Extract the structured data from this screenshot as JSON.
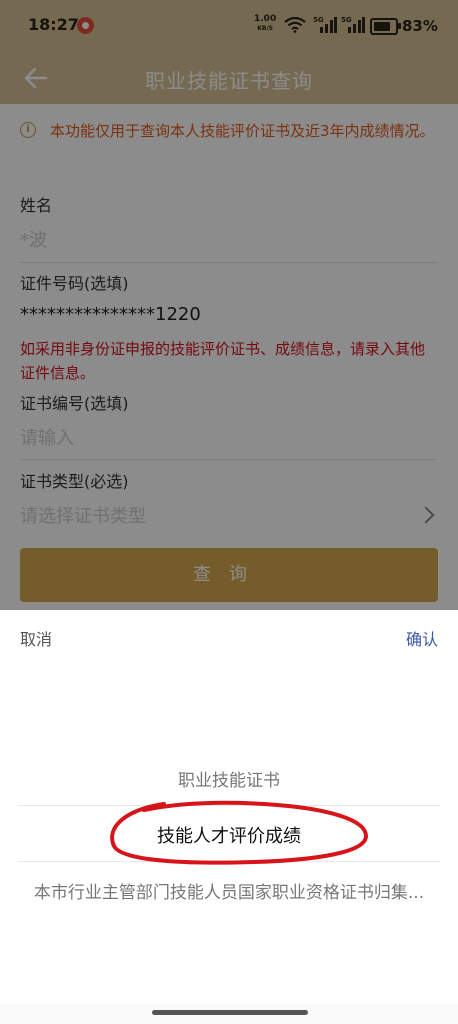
{
  "status_bar": {
    "time": "18:27",
    "net_speed": "1.00",
    "net_unit": "KB/S",
    "sig1_label": "5G",
    "sig2_label": "5G",
    "battery": "83%"
  },
  "header": {
    "title": "职业技能证书查询"
  },
  "notice": "本功能仅用于查询本人技能评价证书及近3年内成绩情况。",
  "form": {
    "name_label": "姓名",
    "name_value": "*波",
    "id_label": "证件号码(选填)",
    "id_value": "***************1220",
    "warning": "如采用非身份证申报的技能评价证书、成绩信息，请录入其他证件信息。",
    "cert_no_label": "证书编号(选填)",
    "cert_no_placeholder": "请输入",
    "cert_type_label": "证书类型(必选)",
    "cert_type_placeholder": "请选择证书类型",
    "query_button": "查询"
  },
  "picker": {
    "cancel": "取消",
    "confirm": "确认",
    "options": [
      "职业技能证书",
      "技能人才评价成绩",
      "本市行业主管部门技能人员国家职业资格证书归集..."
    ],
    "selected_index": 1
  },
  "colors": {
    "header_bg": "#d6c294",
    "accent_button": "#d6a94f",
    "warning_text": "#d4111e",
    "notice_text": "#e05a1a",
    "confirm_text": "#3c57a8",
    "annotation_circle": "#d8141b"
  }
}
